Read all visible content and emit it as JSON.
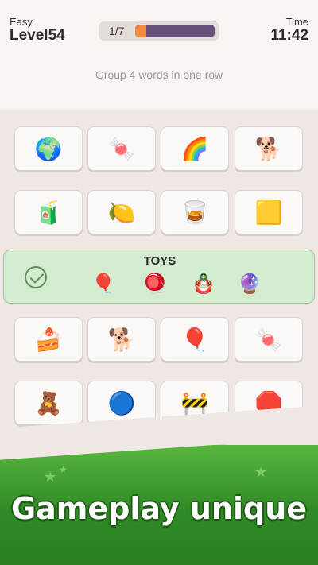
{
  "header": {
    "difficulty": "Easy",
    "level": "Level54",
    "time_label": "Time",
    "time": "11:42",
    "progress_text": "1/7",
    "progress_fraction": 0.14
  },
  "instruction": "Group 4 words in one row",
  "grid": {
    "row1": [
      "globe-icon",
      "candy-icon",
      "rainbow-icon",
      "dalmatian-icon"
    ],
    "row2": [
      "apple-juice-icon",
      "lemonade-icon",
      "whiskey-glass-icon",
      "red-yellow-card-icon"
    ],
    "row4": [
      "rainbow-cake-icon",
      "shiba-dog-icon",
      "hot-air-balloon-icon",
      "wrapped-candy-icon"
    ],
    "row5": [
      "gummy-bear-icon",
      "blue-ball-icon",
      "caution-tape-icon",
      "stop-sign-icon"
    ]
  },
  "solved_group": {
    "title": "TOYS",
    "items": [
      "balloon-dog-icon",
      "spinning-top-icon",
      "matryoshka-icon",
      "marbles-icon"
    ]
  },
  "banner": {
    "text": "Gameplay unique"
  }
}
